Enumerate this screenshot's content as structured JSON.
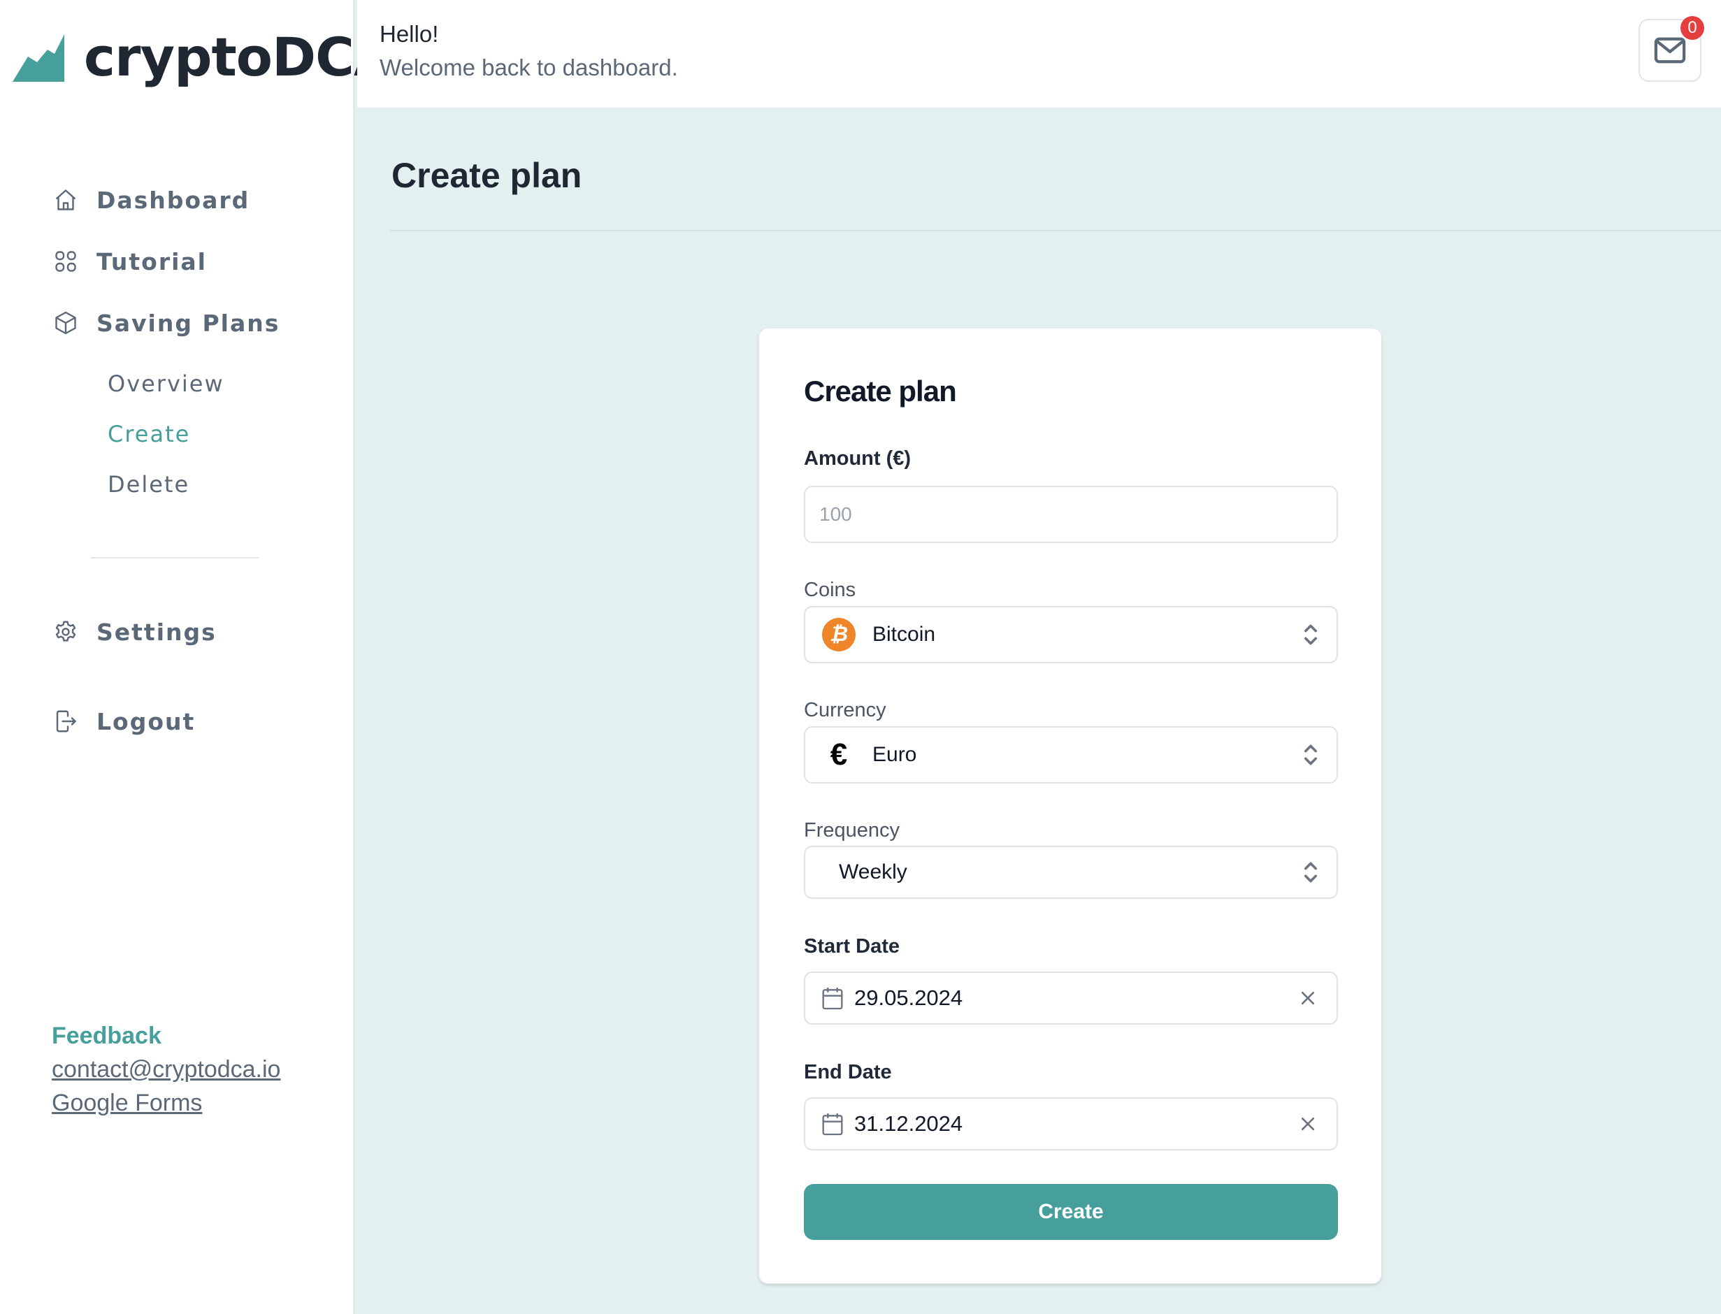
{
  "app": {
    "name": "cryptoDCA",
    "accent_color": "#469f9a",
    "logo_icon": "chart-mountain-icon"
  },
  "sidebar": {
    "items": [
      {
        "label": "Dashboard",
        "icon": "home-icon"
      },
      {
        "label": "Tutorial",
        "icon": "grid-icon"
      },
      {
        "label": "Saving Plans",
        "icon": "cube-icon"
      }
    ],
    "sub_items": [
      {
        "label": "Overview",
        "active": false
      },
      {
        "label": "Create",
        "active": true
      },
      {
        "label": "Delete",
        "active": false
      }
    ],
    "settings": {
      "label": "Settings",
      "icon": "gear-icon"
    },
    "logout": {
      "label": "Logout",
      "icon": "logout-icon"
    },
    "feedback": {
      "title": "Feedback",
      "email": "contact@cryptodca.io",
      "forms": "Google Forms"
    }
  },
  "header": {
    "greeting": "Hello!",
    "welcome": "Welcome back to dashboard.",
    "mail_icon": "mail-icon",
    "mail_count": "0",
    "badge_color": "#e53e3e"
  },
  "main": {
    "page_title": "Create plan"
  },
  "form": {
    "title": "Create plan",
    "amount": {
      "label": "Amount (€)",
      "placeholder": "100",
      "value": ""
    },
    "coins": {
      "label": "Coins",
      "value": "Bitcoin",
      "icon": "bitcoin-icon",
      "icon_glyph": "₿"
    },
    "currency": {
      "label": "Currency",
      "value": "Euro",
      "icon": "euro-icon",
      "icon_glyph": "€"
    },
    "frequency": {
      "label": "Frequency",
      "value": "Weekly"
    },
    "start_date": {
      "label": "Start Date",
      "value": "29.05.2024"
    },
    "end_date": {
      "label": "End Date",
      "value": "31.12.2024"
    },
    "submit_label": "Create"
  }
}
